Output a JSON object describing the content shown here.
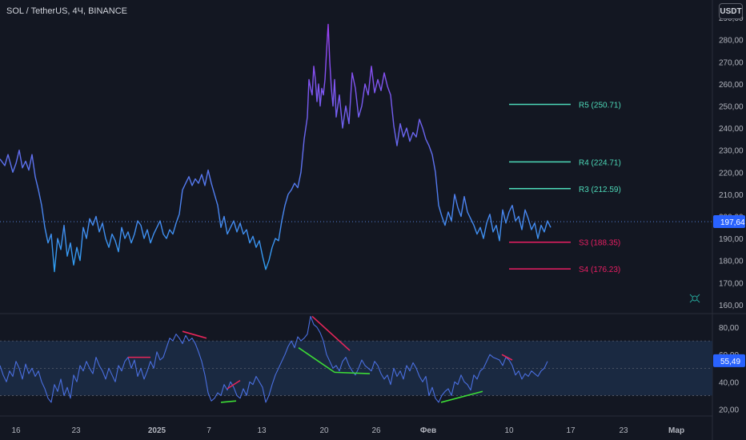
{
  "header": {
    "symbol_title": "SOL / TetherUS, 4Ч, BINANCE",
    "currency_label": "USDT"
  },
  "colors": {
    "background": "#131722",
    "price_line_low": "#2e9ff0",
    "price_line_high": "#9c40f5",
    "support": "#e91e63",
    "resistance": "#4dd9b8",
    "rsi_line": "#4a6fe0",
    "rsi_band": "#1c2b45",
    "bull_div": "#3ddc36",
    "bear_div": "#e8265a",
    "current_price_badge": "#2962ff",
    "axis_text": "#b2b5be"
  },
  "chart_data": [
    {
      "type": "line",
      "name": "price",
      "y_tick_labels": [
        "290,00",
        "280,00",
        "270,00",
        "260,00",
        "250,00",
        "240,00",
        "230,00",
        "220,00",
        "210,00",
        "200,00",
        "190,00",
        "180,00",
        "170,00",
        "160,00"
      ],
      "y_ticks": [
        290,
        280,
        270,
        260,
        250,
        240,
        230,
        220,
        210,
        200,
        190,
        180,
        170,
        160
      ],
      "ylim": [
        156,
        298
      ],
      "current_price": 197.64,
      "current_price_label": "197,64",
      "x": [
        0,
        6,
        10,
        16,
        20,
        24,
        28,
        32,
        36,
        40,
        44,
        48,
        52,
        56,
        60,
        64,
        68,
        72,
        76,
        80,
        84,
        88,
        92,
        96,
        100,
        104,
        108,
        112,
        116,
        120,
        124,
        128,
        132,
        136,
        140,
        144,
        148,
        152,
        156,
        160,
        164,
        168,
        172,
        176,
        180,
        184,
        188,
        192,
        196,
        200,
        204,
        208,
        212,
        216,
        220,
        224,
        228,
        232,
        236,
        240,
        244,
        248,
        252,
        256,
        260,
        264,
        268,
        272,
        276,
        280,
        284,
        288,
        292,
        296,
        300,
        304,
        308,
        312,
        316,
        320,
        324,
        328,
        332,
        336,
        340,
        344,
        348,
        352,
        356,
        360,
        364,
        368,
        372,
        376,
        380,
        384,
        386,
        388,
        390,
        392,
        394,
        396,
        398,
        400,
        402,
        404,
        406,
        408,
        410,
        412,
        414,
        416,
        418,
        420,
        424,
        428,
        432,
        436,
        440,
        444,
        448,
        452,
        456,
        460,
        464,
        468,
        472,
        476,
        480,
        484,
        488,
        492,
        496,
        500,
        504,
        508,
        512,
        516,
        520,
        524,
        528,
        532,
        536,
        540,
        544,
        548,
        552,
        556,
        560,
        564,
        568,
        572,
        576,
        580,
        584,
        588,
        592,
        596,
        600,
        604,
        608,
        612,
        616,
        620,
        624,
        628,
        632,
        636,
        640,
        644,
        648,
        652,
        656,
        660,
        664,
        668,
        672,
        676,
        680,
        684,
        688
      ],
      "y": [
        226,
        223,
        228,
        220,
        224,
        230,
        222,
        225,
        221,
        228,
        218,
        212,
        205,
        195,
        188,
        192,
        175,
        190,
        185,
        196,
        182,
        188,
        178,
        186,
        180,
        195,
        190,
        199,
        196,
        200,
        193,
        197,
        190,
        186,
        192,
        189,
        184,
        195,
        190,
        193,
        188,
        192,
        198,
        196,
        190,
        194,
        188,
        192,
        195,
        198,
        192,
        190,
        194,
        192,
        197,
        201,
        212,
        215,
        218,
        214,
        217,
        215,
        219,
        214,
        221,
        215,
        210,
        205,
        195,
        200,
        192,
        195,
        198,
        193,
        197,
        192,
        194,
        188,
        191,
        186,
        189,
        182,
        176,
        180,
        186,
        190,
        189,
        198,
        205,
        210,
        212,
        215,
        213,
        220,
        235,
        245,
        262,
        258,
        255,
        268,
        262,
        252,
        260,
        250,
        258,
        255,
        262,
        275,
        287,
        270,
        258,
        250,
        262,
        245,
        255,
        240,
        250,
        242,
        265,
        258,
        245,
        250,
        260,
        255,
        268,
        256,
        262,
        257,
        265,
        259,
        255,
        241,
        232,
        242,
        236,
        240,
        234,
        238,
        236,
        244,
        240,
        235,
        232,
        228,
        220,
        205,
        200,
        196,
        202,
        198,
        210,
        204,
        200,
        209,
        202,
        199,
        196,
        192,
        195,
        190,
        197,
        201,
        193,
        196,
        189,
        203,
        197,
        202,
        205,
        198,
        200,
        194,
        203,
        199,
        194,
        197,
        190,
        196,
        193,
        198,
        195,
        197
      ],
      "levels": [
        {
          "label": "R5 (250.71)",
          "value": 250.71,
          "kind": "resistance"
        },
        {
          "label": "R4 (224.71)",
          "value": 224.71,
          "kind": "resistance"
        },
        {
          "label": "R3 (212.59)",
          "value": 212.59,
          "kind": "resistance"
        },
        {
          "label": "S3 (188.35)",
          "value": 188.35,
          "kind": "support"
        },
        {
          "label": "S4 (176.23)",
          "value": 176.23,
          "kind": "support"
        }
      ]
    },
    {
      "type": "line",
      "name": "rsi",
      "y_tick_labels": [
        "80,00",
        "60,00",
        "40,00",
        "20,00"
      ],
      "y_ticks": [
        80,
        60,
        40,
        20
      ],
      "ylim": [
        15,
        90
      ],
      "band": [
        30,
        70
      ],
      "midline": 50,
      "current_value": 55.49,
      "current_value_label": "55,49",
      "x": [
        0,
        4,
        8,
        12,
        16,
        20,
        24,
        28,
        32,
        36,
        40,
        44,
        48,
        52,
        56,
        60,
        64,
        68,
        72,
        76,
        80,
        84,
        88,
        92,
        96,
        100,
        104,
        108,
        112,
        116,
        120,
        124,
        128,
        132,
        136,
        140,
        144,
        148,
        152,
        156,
        160,
        164,
        168,
        172,
        176,
        180,
        184,
        188,
        192,
        196,
        200,
        204,
        208,
        212,
        216,
        220,
        224,
        228,
        232,
        236,
        240,
        244,
        248,
        252,
        256,
        260,
        264,
        268,
        272,
        276,
        280,
        284,
        288,
        292,
        296,
        300,
        304,
        308,
        312,
        316,
        320,
        324,
        328,
        332,
        336,
        340,
        344,
        348,
        352,
        356,
        360,
        364,
        368,
        372,
        376,
        380,
        384,
        388,
        392,
        396,
        400,
        404,
        408,
        412,
        416,
        420,
        424,
        428,
        432,
        436,
        440,
        444,
        448,
        452,
        456,
        460,
        464,
        468,
        472,
        476,
        480,
        484,
        488,
        492,
        496,
        500,
        504,
        508,
        512,
        516,
        520,
        524,
        528,
        532,
        536,
        540,
        544,
        548,
        552,
        556,
        560,
        564,
        568,
        572,
        576,
        580,
        584,
        588,
        592,
        596,
        600,
        604,
        608,
        612,
        616,
        620,
        624,
        628,
        632,
        636,
        640,
        644,
        648,
        652,
        656,
        660,
        664,
        668,
        672,
        676,
        680,
        684,
        688
      ],
      "y": [
        52,
        45,
        40,
        48,
        44,
        55,
        50,
        42,
        53,
        46,
        50,
        44,
        48,
        40,
        35,
        28,
        25,
        38,
        33,
        42,
        30,
        36,
        28,
        45,
        40,
        52,
        48,
        55,
        50,
        46,
        58,
        52,
        48,
        42,
        50,
        45,
        40,
        52,
        48,
        55,
        58,
        50,
        56,
        44,
        50,
        42,
        48,
        55,
        50,
        62,
        56,
        58,
        65,
        72,
        70,
        75,
        72,
        68,
        74,
        70,
        72,
        68,
        62,
        55,
        45,
        32,
        26,
        28,
        32,
        30,
        38,
        34,
        40,
        36,
        30,
        28,
        35,
        30,
        40,
        38,
        44,
        40,
        36,
        25,
        30,
        38,
        45,
        50,
        55,
        60,
        66,
        70,
        65,
        73,
        70,
        72,
        75,
        88,
        82,
        80,
        76,
        70,
        60,
        55,
        50,
        52,
        48,
        55,
        58,
        52,
        48,
        45,
        50,
        56,
        52,
        50,
        48,
        55,
        52,
        46,
        42,
        45,
        38,
        50,
        44,
        48,
        42,
        52,
        48,
        54,
        50,
        44,
        40,
        44,
        30,
        36,
        28,
        25,
        30,
        33,
        35,
        30,
        40,
        38,
        45,
        40,
        38,
        34,
        45,
        42,
        48,
        50,
        55,
        60,
        58,
        57,
        56,
        52,
        58,
        56,
        52,
        45,
        48,
        42,
        46,
        44,
        48,
        46,
        44,
        48,
        50,
        55
      ]
    }
  ],
  "x_axis": {
    "ticks": [
      {
        "label": "16",
        "x": 20,
        "bold": false
      },
      {
        "label": "23",
        "x": 95,
        "bold": false
      },
      {
        "label": "2025",
        "x": 196,
        "bold": true
      },
      {
        "label": "7",
        "x": 261,
        "bold": false
      },
      {
        "label": "13",
        "x": 327,
        "bold": false
      },
      {
        "label": "20",
        "x": 405,
        "bold": false
      },
      {
        "label": "26",
        "x": 470,
        "bold": false
      },
      {
        "label": "Фев",
        "x": 535,
        "bold": true
      },
      {
        "label": "10",
        "x": 636,
        "bold": false
      },
      {
        "label": "17",
        "x": 713,
        "bold": false
      },
      {
        "label": "23",
        "x": 779,
        "bold": false
      },
      {
        "label": "Мар",
        "x": 845,
        "bold": true
      }
    ]
  },
  "divergences": {
    "bearish": [
      {
        "x1": 160,
        "y1": 58,
        "x2": 188,
        "y2": 58
      },
      {
        "x1": 228,
        "y1": 77,
        "x2": 258,
        "y2": 72
      },
      {
        "x1": 284,
        "y1": 35,
        "x2": 300,
        "y2": 41
      },
      {
        "x1": 390,
        "y1": 88,
        "x2": 437,
        "y2": 63
      },
      {
        "x1": 627,
        "y1": 60,
        "x2": 640,
        "y2": 56
      }
    ],
    "bullish": [
      {
        "x1": 276,
        "y1": 25,
        "x2": 295,
        "y2": 26
      },
      {
        "x1": 373,
        "y1": 65,
        "x2": 418,
        "y2": 47
      },
      {
        "x1": 418,
        "y1": 47,
        "x2": 462,
        "y2": 46
      },
      {
        "x1": 551,
        "y1": 25,
        "x2": 603,
        "y2": 33
      }
    ]
  }
}
